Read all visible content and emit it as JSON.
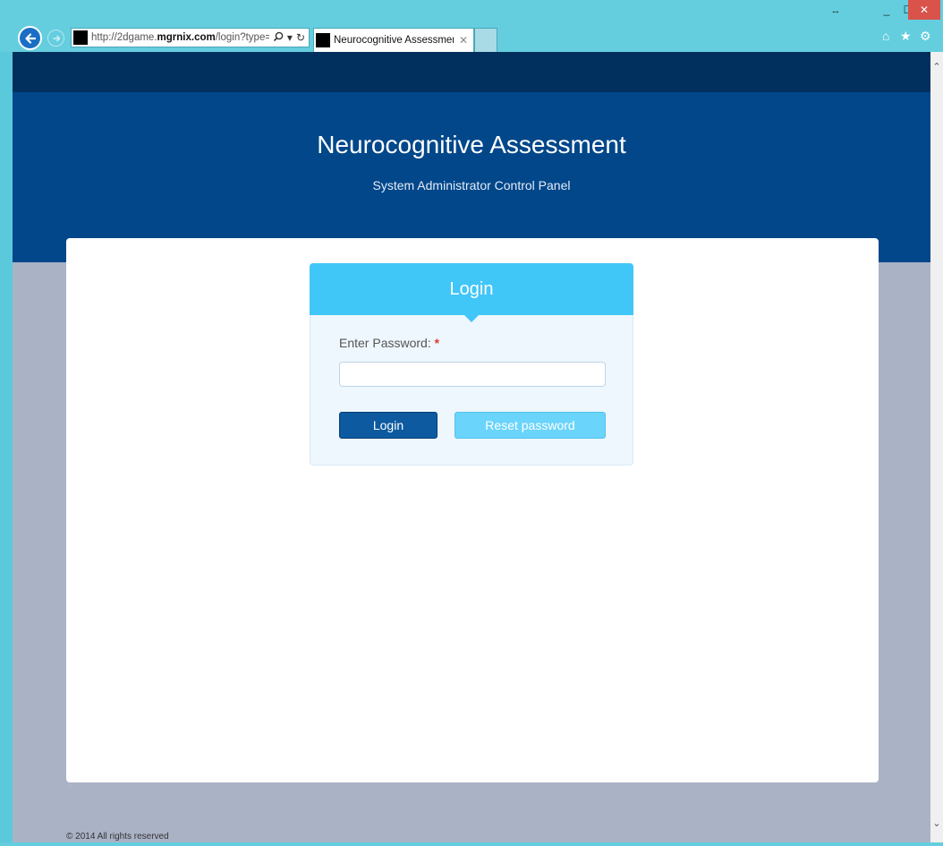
{
  "browser": {
    "url_prefix": "http://2dgame.",
    "url_domain": "mgrnix.com",
    "url_path": "/login?type=",
    "tab_title": "Neurocognitive Assessmen...",
    "icons": {
      "back": "back-arrow-icon",
      "forward": "forward-arrow-icon",
      "search": "search-icon",
      "refresh": "refresh-icon",
      "home": "home-icon",
      "favorites": "star-icon",
      "settings": "gear-icon"
    }
  },
  "header": {
    "title": "Neurocognitive Assessment",
    "subtitle": "System Administrator Control Panel"
  },
  "login": {
    "heading": "Login",
    "password_label": "Enter Password:",
    "required_marker": "*",
    "password_value": "",
    "login_button": "Login",
    "reset_button": "Reset password"
  },
  "footer": {
    "copyright": "© 2014 All rights reserved"
  },
  "colors": {
    "header_bg": "#01478a",
    "topbar_bg": "#02305e",
    "login_head_bg": "#41c6f8",
    "login_button_bg": "#0d5aa1",
    "reset_button_bg": "#6ad4fb"
  }
}
